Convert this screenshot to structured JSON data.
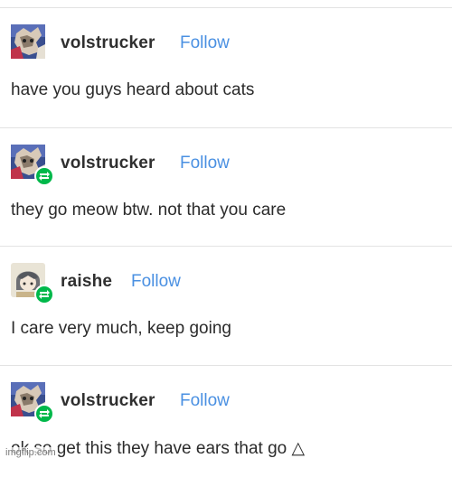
{
  "colors": {
    "follow": "#4a90e2",
    "reblog_badge": "#00b84a",
    "divider": "#e3e3e3"
  },
  "posts": [
    {
      "username": "volstrucker",
      "follow_label": "Follow",
      "text": "have you guys heard about cats",
      "avatar": "volstrucker-avatar",
      "reblog": false
    },
    {
      "username": "volstrucker",
      "follow_label": "Follow",
      "text": "they go meow btw. not that you care",
      "avatar": "volstrucker-avatar",
      "reblog": true
    },
    {
      "username": "raishe",
      "follow_label": "Follow",
      "text": "I care very much, keep going",
      "avatar": "raishe-avatar",
      "reblog": true
    },
    {
      "username": "volstrucker",
      "follow_label": "Follow",
      "text": "ok so get this they have ears that go △",
      "avatar": "volstrucker-avatar",
      "reblog": true
    }
  ],
  "watermark": "imgflip.com"
}
